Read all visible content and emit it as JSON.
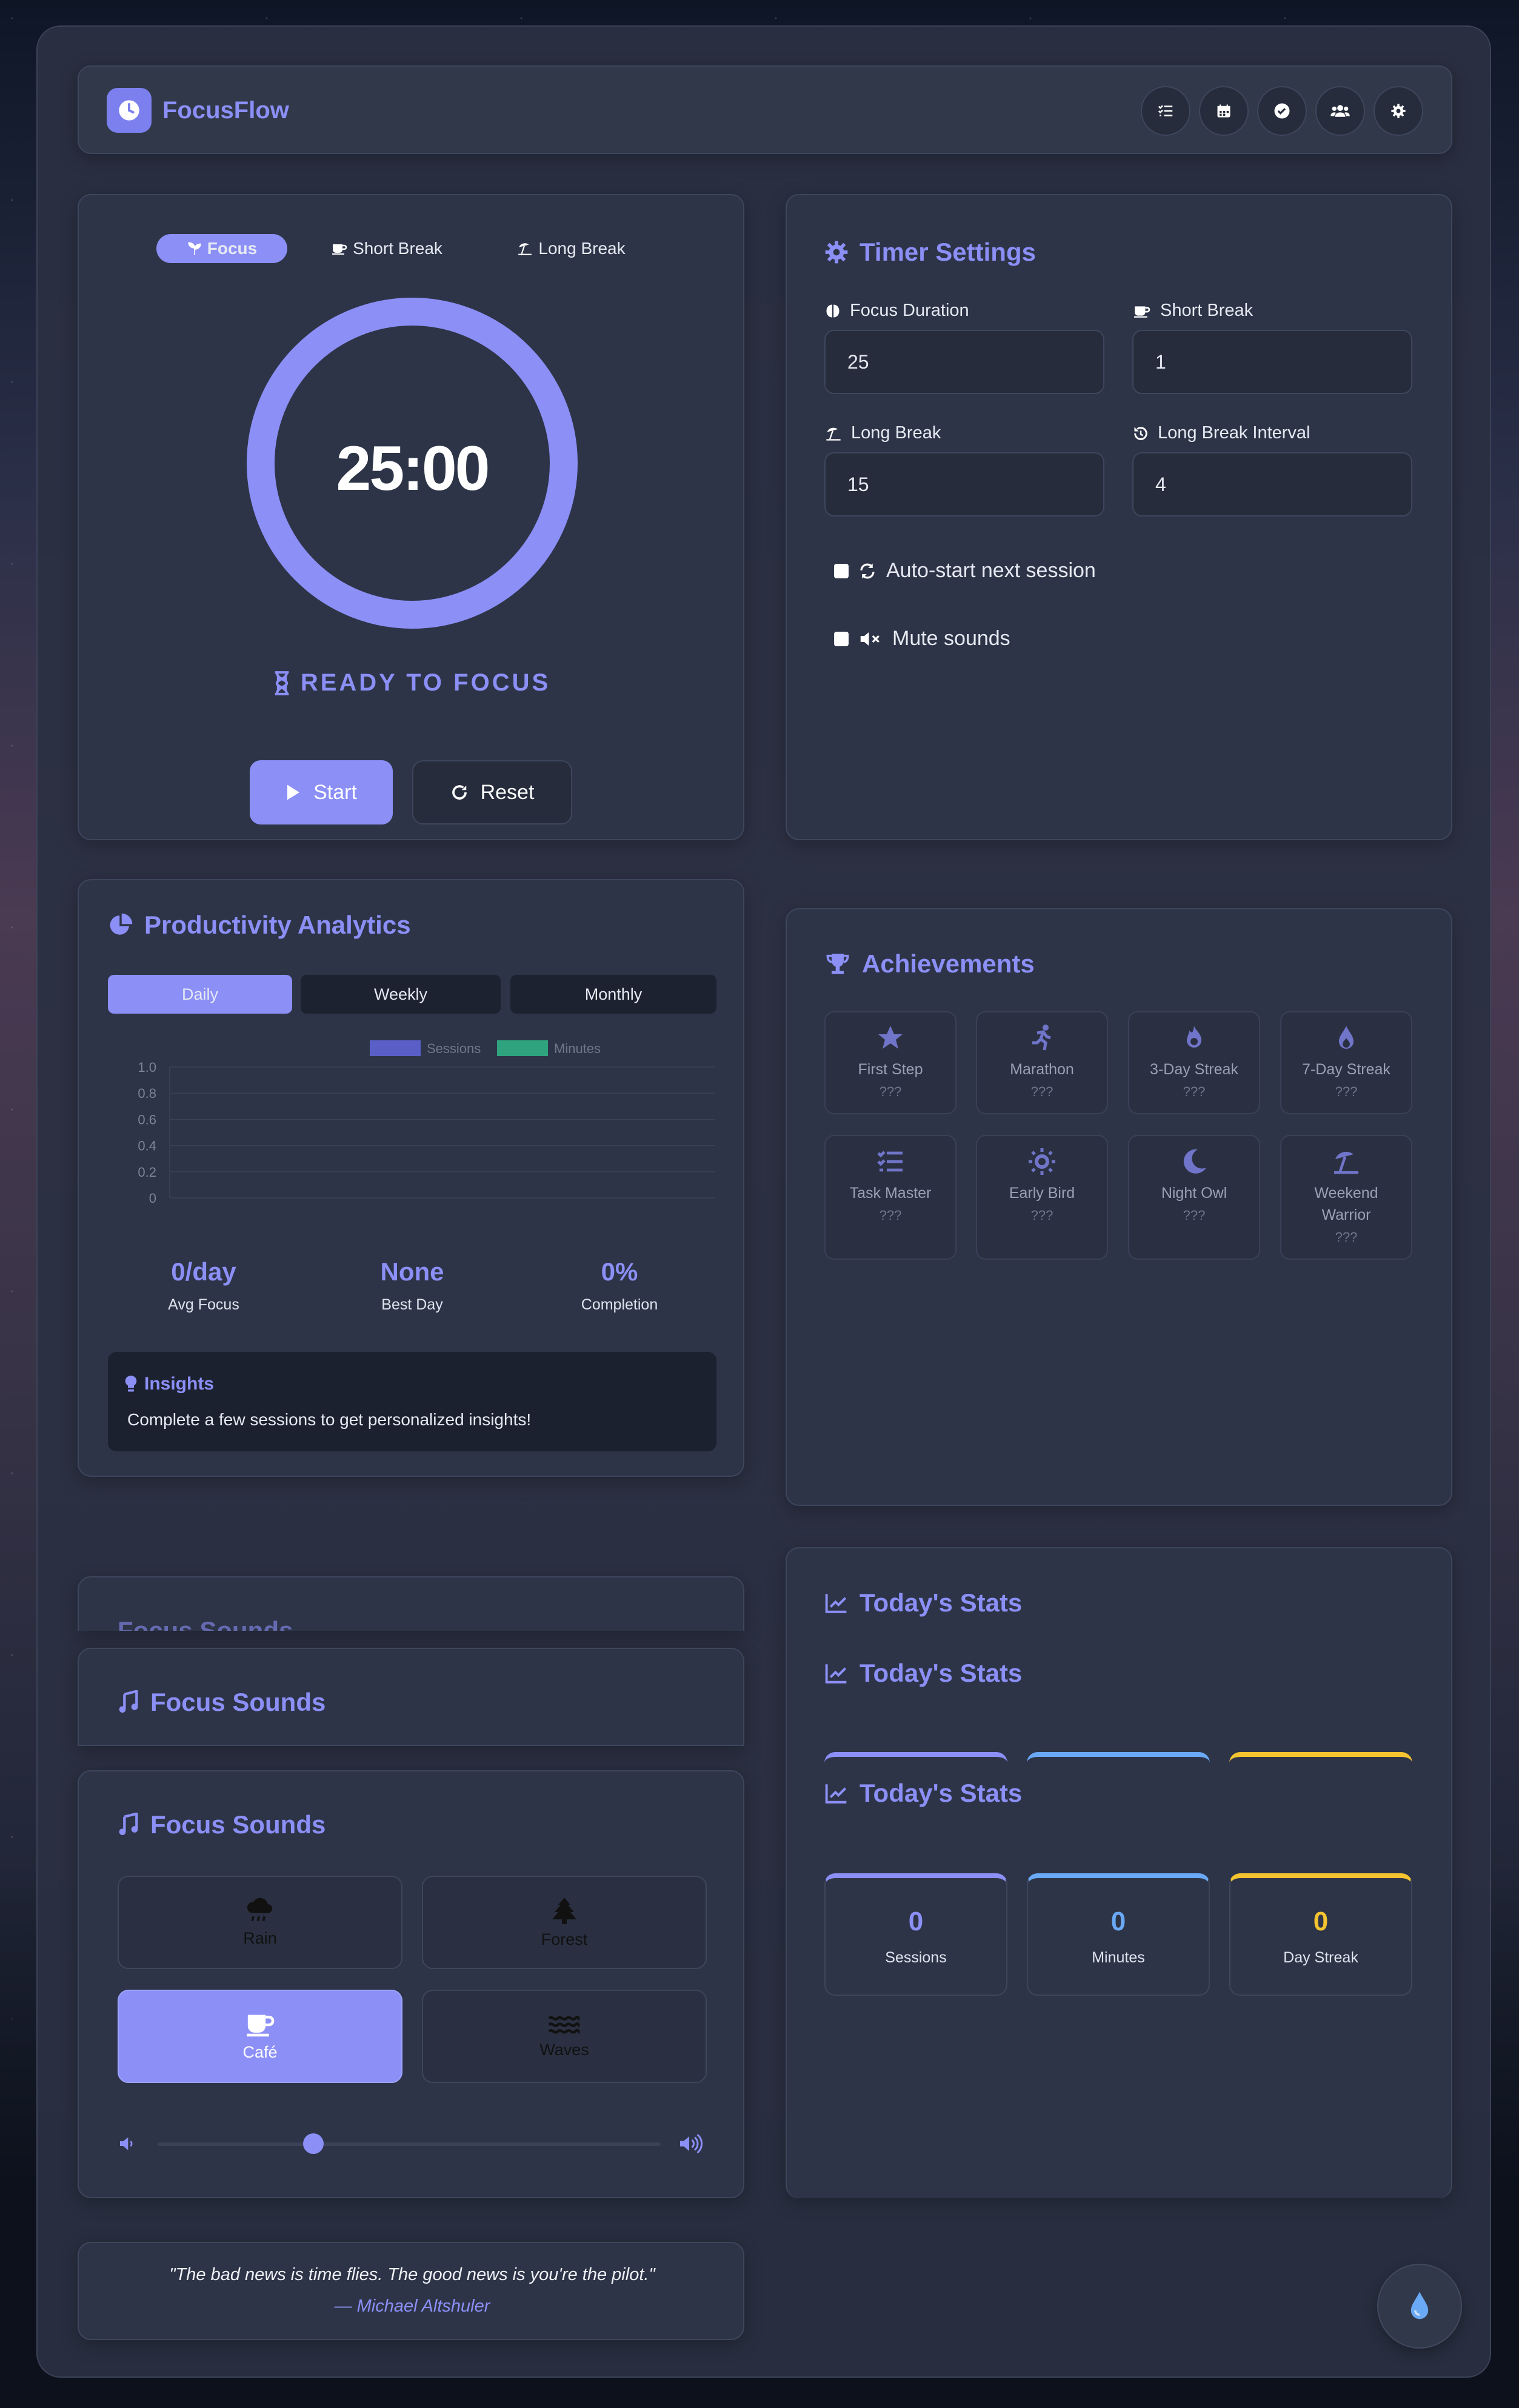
{
  "app": {
    "name": "FocusFlow"
  },
  "colors": {
    "accent": "#8b8ff6",
    "blue": "#6aa9f5",
    "yellow": "#f4c430",
    "card": "#2d3447"
  },
  "header": {
    "icons": [
      "tasks-icon",
      "calendar-icon",
      "check-circle-icon",
      "users-icon",
      "gear-icon"
    ]
  },
  "timer": {
    "modes": [
      "Focus",
      "Short Break",
      "Long Break"
    ],
    "active_mode": "Focus",
    "time": "25:00",
    "status": "READY TO FOCUS",
    "start_label": "Start",
    "reset_label": "Reset"
  },
  "settings": {
    "title": "Timer Settings",
    "focus_label": "Focus Duration",
    "focus_value": "25",
    "short_label": "Short Break",
    "short_value": "1",
    "long_label": "Long Break",
    "long_value": "15",
    "interval_label": "Long Break Interval",
    "interval_value": "4",
    "autostart_label": "Auto-start next session",
    "mute_label": "Mute sounds"
  },
  "analytics": {
    "title": "Productivity Analytics",
    "tabs": [
      "Daily",
      "Weekly",
      "Monthly"
    ],
    "avg_value": "0/day",
    "avg_label": "Avg Focus",
    "best_value": "None",
    "best_label": "Best Day",
    "completion_value": "0%",
    "completion_label": "Completion",
    "insights_title": "Insights",
    "insights_text": "Complete a few sessions to get personalized insights!"
  },
  "chart_data": {
    "type": "bar",
    "categories": [],
    "series": [
      {
        "name": "Sessions",
        "values": [],
        "color": "#5a5fc8"
      },
      {
        "name": "Minutes",
        "values": [],
        "color": "#2fa37e"
      }
    ],
    "ylim": [
      0,
      1.0
    ],
    "yticks": [
      "1.0",
      "0.8",
      "0.6",
      "0.4",
      "0.2",
      "0"
    ],
    "legend": "top-center",
    "grid": true
  },
  "achievements": {
    "title": "Achievements",
    "items": [
      {
        "name": "First Step",
        "status": "???",
        "icon": "star-icon"
      },
      {
        "name": "Marathon",
        "status": "???",
        "icon": "runner-icon"
      },
      {
        "name": "3-Day Streak",
        "status": "???",
        "icon": "fire-icon"
      },
      {
        "name": "7-Day Streak",
        "status": "???",
        "icon": "flame-icon"
      },
      {
        "name": "Task Master",
        "status": "???",
        "icon": "tasks-icon"
      },
      {
        "name": "Early Bird",
        "status": "???",
        "icon": "sun-icon"
      },
      {
        "name": "Night Owl",
        "status": "???",
        "icon": "moon-icon"
      },
      {
        "name": "Weekend Warrior",
        "status": "???",
        "icon": "umbrella-beach-icon"
      }
    ]
  },
  "sounds": {
    "title": "Focus Sounds",
    "ghost_title": "Focus Sounds",
    "items": [
      "Rain",
      "Forest",
      "Café",
      "Waves"
    ],
    "active": "Café",
    "volume": 0.31
  },
  "today": {
    "title": "Today's Stats",
    "sessions_value": "0",
    "sessions_label": "Sessions",
    "minutes_value": "0",
    "minutes_label": "Minutes",
    "streak_value": "0",
    "streak_label": "Day Streak"
  },
  "quote": {
    "text": "\"The bad news is time flies. The good news is you're the pilot.\"",
    "author": "— Michael Altshuler"
  }
}
